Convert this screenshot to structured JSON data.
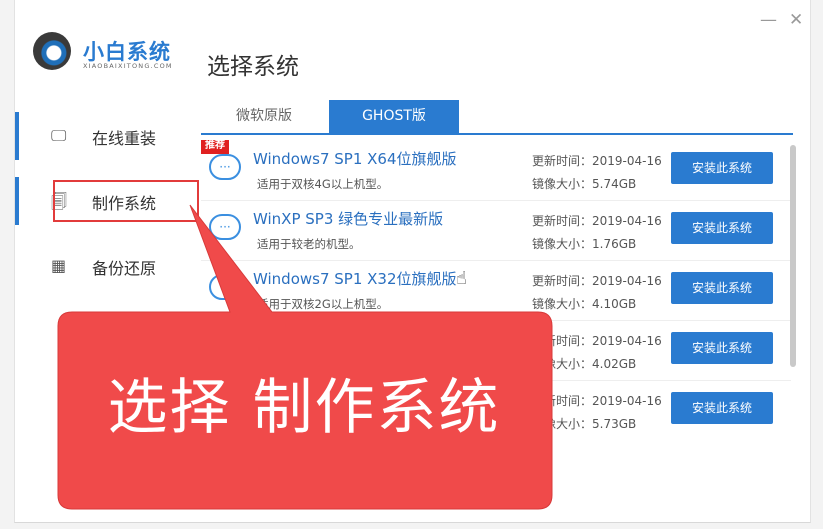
{
  "app": {
    "logo_cn": "小白系统",
    "logo_en": "XIAOBAIXITONG.COM",
    "page_title": "选择系统",
    "minimize_glyph": "—",
    "close_glyph": "✕"
  },
  "sidebar": {
    "items": [
      {
        "label": "在线重装",
        "icon": "monitor-icon",
        "glyph": "🖵"
      },
      {
        "label": "制作系统",
        "icon": "usb-icon",
        "glyph": "🗐"
      },
      {
        "label": "备份还原",
        "icon": "grid-icon",
        "glyph": "▦"
      }
    ]
  },
  "tabs": [
    {
      "label": "微软原版",
      "active": false
    },
    {
      "label": "GHOST版",
      "active": true
    }
  ],
  "systems": [
    {
      "badge": "推荐",
      "name": "Windows7 SP1 X64位旗舰版",
      "desc": "适用于双核4G以上机型。",
      "time": "更新时间：2019-04-16",
      "size": "镜像大小：5.74GB",
      "button": "安装此系统"
    },
    {
      "badge": "",
      "name": "WinXP SP3 绿色专业最新版",
      "desc": "适用于较老的机型。",
      "time": "更新时间：2019-04-16",
      "size": "镜像大小：1.76GB",
      "button": "安装此系统"
    },
    {
      "badge": "",
      "name": "Windows7 SP1 X32位旗舰版",
      "desc": "适用于双核2G以上机型。",
      "time": "更新时间：2019-04-16",
      "size": "镜像大小：4.10GB",
      "button": "安装此系统"
    },
    {
      "badge": "",
      "name": "",
      "desc": "",
      "time": "更新时间：2019-04-16",
      "size": "镜像大小：4.02GB",
      "button": "安装此系统"
    },
    {
      "badge": "",
      "name": "",
      "desc": "",
      "time": "更新时间：2019-04-16",
      "size": "镜像大小：5.73GB",
      "button": "安装此系统"
    }
  ],
  "overlay": {
    "text": "选择 制作系统"
  },
  "colors": {
    "accent": "#2a7bd0",
    "callout": "#f04a4a",
    "badge": "#e02020"
  }
}
